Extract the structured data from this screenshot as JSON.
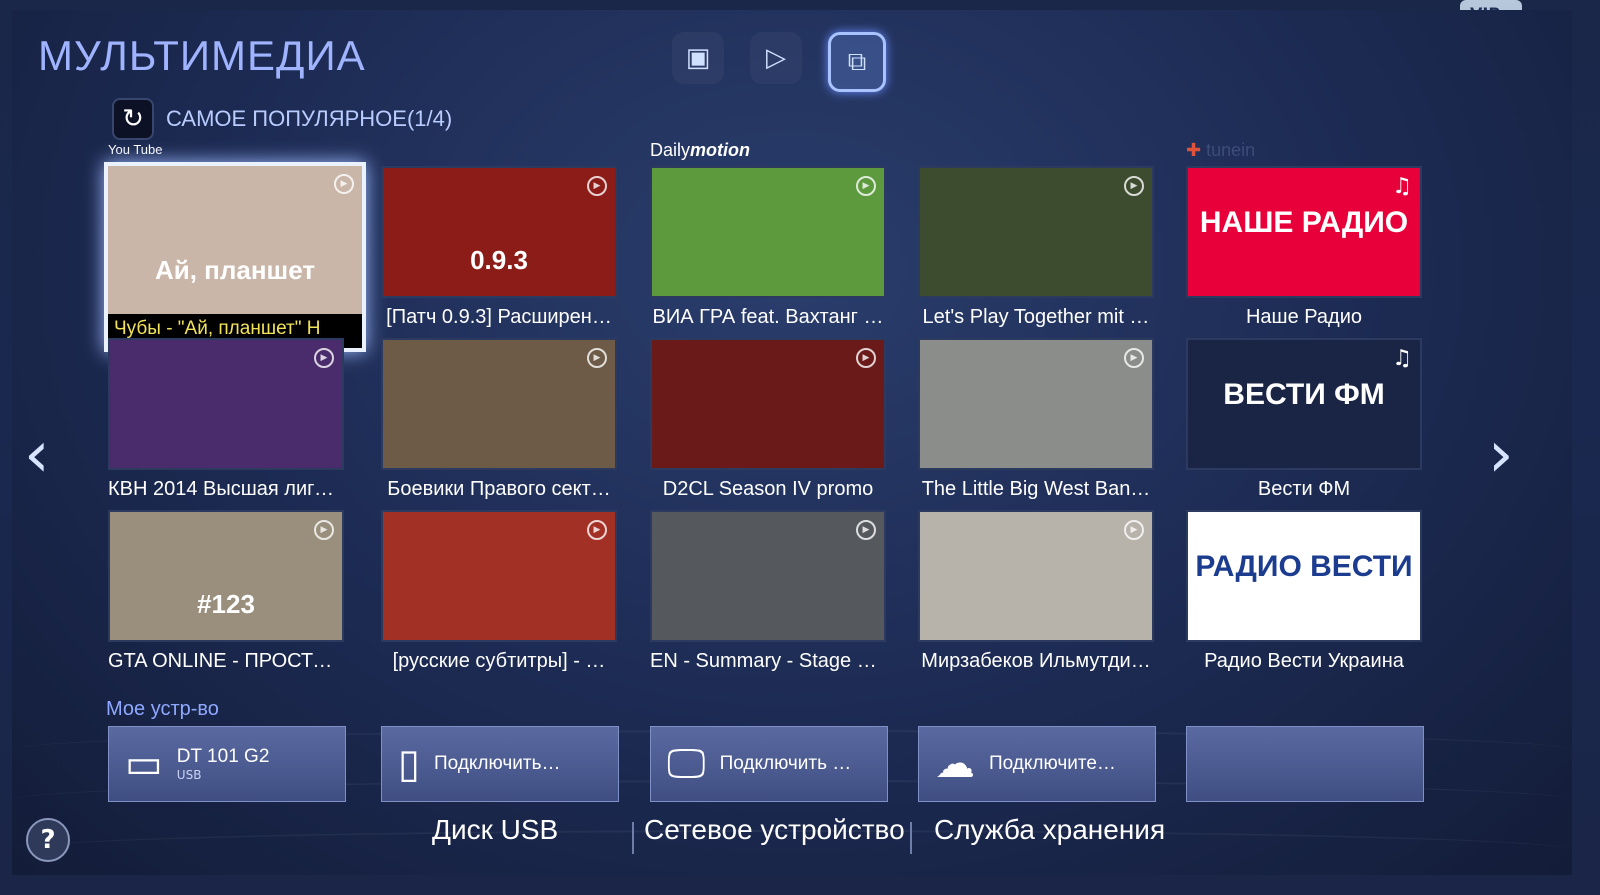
{
  "header": {
    "title": "МУЛЬТИМЕДИА",
    "icons": [
      "photos-icon",
      "play-icon",
      "screen-mirror-icon"
    ]
  },
  "section": {
    "label": "САМОЕ ПОПУЛЯРНОЕ(1/4)"
  },
  "providers": {
    "youtube": "You Tube",
    "dailymotion": "Daily",
    "dailymotion_em": "motion",
    "tunein": "tunein"
  },
  "tiles": [
    {
      "caption": "Чубы - \"Ай, планшет\"   Н",
      "thumb_text": "Ай, планшет",
      "color": "#c9b6a8"
    },
    {
      "caption": "[Патч 0.9.3] Расширен…",
      "thumb_text": "0.9.3",
      "color": "#8c1c18"
    },
    {
      "caption": "ВИА ГРА feat. Вахтанг …",
      "thumb_text": "",
      "color": "#5d9a3e"
    },
    {
      "caption": "Let's Play Together mit …",
      "thumb_text": "",
      "color": "#3d4c2f"
    },
    {
      "caption": "Наше Радио",
      "thumb_text": "НАШЕ РАДИО",
      "color": "#e8003a"
    },
    {
      "caption": "КВН 2014 Высшая лига…",
      "thumb_text": "",
      "color": "#4a2b6b"
    },
    {
      "caption": "Боевики Правого сект…",
      "thumb_text": "",
      "color": "#6d5a47"
    },
    {
      "caption": "D2CL Season IV promo",
      "thumb_text": "",
      "color": "#6b1a1a"
    },
    {
      "caption": "The Little Big West Ban…",
      "thumb_text": "",
      "color": "#8a8d8a"
    },
    {
      "caption": "Вести ФМ",
      "thumb_text": "ВЕСТИ ФМ",
      "color": "#1a2546"
    },
    {
      "caption": "GTA ONLINE - ПРОСТО…",
      "thumb_text": "#123",
      "color": "#9a8f7c"
    },
    {
      "caption": "[русские субтитры] - …",
      "thumb_text": "",
      "color": "#a33025"
    },
    {
      "caption": "EN - Summary - Stage 1…",
      "thumb_text": "",
      "color": "#55595e"
    },
    {
      "caption": "Мирзабеков Ильмутди…",
      "thumb_text": "",
      "color": "#b7b2aa"
    },
    {
      "caption": "Радио Вести Украина",
      "thumb_text": "РАДИО ВЕСТИ",
      "color": "#ffffff"
    }
  ],
  "my_devices": {
    "label": "Мое устр-во",
    "devices": [
      {
        "name": "DT 101 G2",
        "sub": "USB",
        "icon": "usb-drive-icon"
      },
      {
        "name": "Подключить…",
        "sub": "",
        "icon": "phone-icon"
      },
      {
        "name": "Подключить …",
        "sub": "",
        "icon": "monitor-icon"
      },
      {
        "name": "Подключите…",
        "sub": "",
        "icon": "cloud-icon"
      },
      {
        "name": "",
        "sub": "",
        "icon": ""
      }
    ]
  },
  "storage_tabs": [
    "Диск USB",
    "Сетевое устройство",
    "Служба хранения"
  ],
  "help": "?",
  "vip": "VIP"
}
